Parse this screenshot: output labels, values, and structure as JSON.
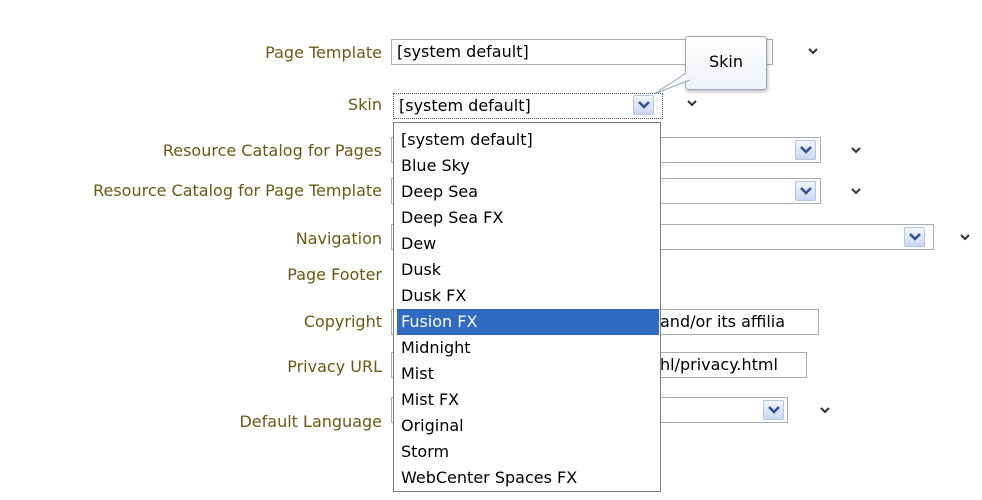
{
  "form": {
    "page_template": {
      "label": "Page Template",
      "value": "[system default]"
    },
    "skin": {
      "label": "Skin",
      "value": "[system default]"
    },
    "resource_catalog_pages": {
      "label": "Resource Catalog for Pages"
    },
    "resource_catalog_template": {
      "label": "Resource Catalog for Page Template"
    },
    "navigation": {
      "label": "Navigation"
    },
    "page_footer": {
      "label": "Page Footer"
    },
    "copyright": {
      "label": "Copyright",
      "value": "and/or its affilia"
    },
    "privacy_url": {
      "label": "Privacy URL",
      "value": "hl/privacy.html"
    },
    "default_language": {
      "label": "Default Language"
    }
  },
  "tooltip": {
    "text": "Skin"
  },
  "skin_dropdown": {
    "options": [
      "[system default]",
      "Blue Sky",
      "Deep Sea",
      "Deep Sea FX",
      "Dew",
      "Dusk",
      "Dusk FX",
      "Fusion FX",
      "Midnight",
      "Mist",
      "Mist FX",
      "Original",
      "Storm",
      "WebCenter Spaces FX"
    ],
    "highlighted": "Fusion FX"
  },
  "colors": {
    "label": "#6b5a12",
    "highlight": "#316ac5",
    "dropdown_arrow": "#2f4f9a"
  }
}
